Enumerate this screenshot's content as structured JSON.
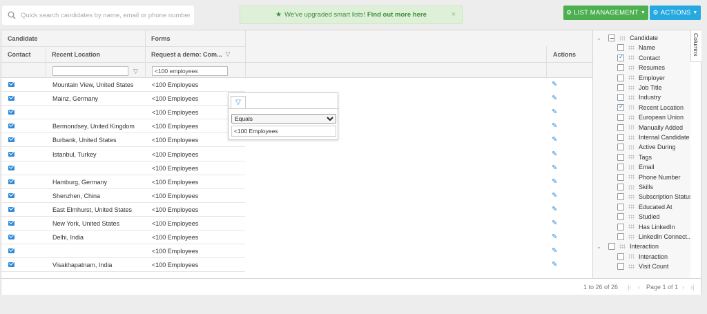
{
  "search": {
    "placeholder": "Quick search candidates by name, email or phone number"
  },
  "banner": {
    "text": "We've upgraded smart lists!",
    "link": "Find out more here",
    "close": "×"
  },
  "toolbar": {
    "list_management": "LIST MANAGEMENT",
    "actions": "ACTIONS"
  },
  "header": {
    "group_candidate": "Candidate",
    "group_forms": "Forms",
    "col_contact": "Contact",
    "col_recent_location": "Recent Location",
    "col_request_demo": "Request a demo: Com...",
    "col_actions": "Actions",
    "filter_form_value": "<100 employees"
  },
  "rows": [
    {
      "location": "Mountain View, United States",
      "form": "<100 Employees"
    },
    {
      "location": "Mainz, Germany",
      "form": "<100 Employees"
    },
    {
      "location": "",
      "form": "<100 Employees"
    },
    {
      "location": "Bermondsey, United Kingdom",
      "form": "<100 Employees"
    },
    {
      "location": "Burbank, United States",
      "form": "<100 Employees"
    },
    {
      "location": "Istanbul, Turkey",
      "form": "<100 Employees"
    },
    {
      "location": "",
      "form": "<100 Employees"
    },
    {
      "location": "Hamburg, Germany",
      "form": "<100 Employees"
    },
    {
      "location": "Shenzhen, China",
      "form": "<100 Employees"
    },
    {
      "location": "East Elmhurst, United States",
      "form": "<100 Employees"
    },
    {
      "location": "New York, United States",
      "form": "<100 Employees"
    },
    {
      "location": "Delhi, India",
      "form": "<100 Employees"
    },
    {
      "location": "",
      "form": "<100 Employees"
    },
    {
      "location": "Visakhapatnam, India",
      "form": "<100 Employees"
    }
  ],
  "filter_popup": {
    "operator": "Equals",
    "value": "<100 Employees"
  },
  "footer": {
    "range": "1 to 26 of 26",
    "page": "Page 1 of 1"
  },
  "columns_panel": {
    "tab": "Columns",
    "groups": [
      {
        "label": "Candidate",
        "items": [
          {
            "label": "Name",
            "checked": false
          },
          {
            "label": "Contact",
            "checked": true
          },
          {
            "label": "Resumes",
            "checked": false
          },
          {
            "label": "Employer",
            "checked": false
          },
          {
            "label": "Job Title",
            "checked": false
          },
          {
            "label": "Industry",
            "checked": false
          },
          {
            "label": "Recent Location",
            "checked": true
          },
          {
            "label": "European Union",
            "checked": false
          },
          {
            "label": "Manually Added",
            "checked": false
          },
          {
            "label": "Internal Candidate",
            "checked": false
          },
          {
            "label": "Active During",
            "checked": false
          },
          {
            "label": "Tags",
            "checked": false
          },
          {
            "label": "Email",
            "checked": false
          },
          {
            "label": "Phone Number",
            "checked": false
          },
          {
            "label": "Skills",
            "checked": false
          },
          {
            "label": "Subscription Status",
            "checked": false
          },
          {
            "label": "Educated At",
            "checked": false
          },
          {
            "label": "Studied",
            "checked": false
          },
          {
            "label": "Has LinkedIn",
            "checked": false
          },
          {
            "label": "LinkedIn Connect...",
            "checked": false
          }
        ]
      },
      {
        "label": "Interaction",
        "items": [
          {
            "label": "Interaction",
            "checked": false
          },
          {
            "label": "Visit Count",
            "checked": false
          }
        ]
      }
    ]
  },
  "colors": {
    "green": "#4caf50",
    "blue": "#26a9e0",
    "link_blue": "#2e8ad8",
    "banner_bg": "#dff0d8"
  }
}
